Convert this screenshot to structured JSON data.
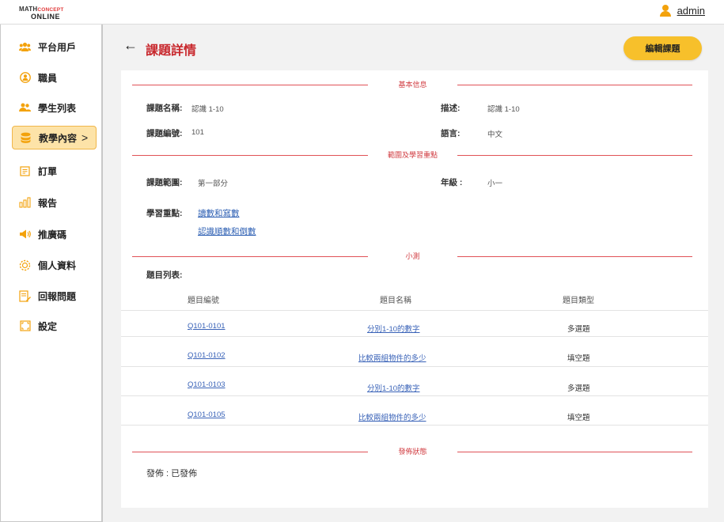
{
  "header": {
    "logo_line1_a": "Math",
    "logo_line1_b": "Concept",
    "logo_line2": "ONLINE",
    "user_name": "admin"
  },
  "sidebar": {
    "items": [
      {
        "label": "平台用戶",
        "icon": "users-icon"
      },
      {
        "label": "職員",
        "icon": "staff-icon"
      },
      {
        "label": "學生列表",
        "icon": "students-icon"
      },
      {
        "label": "教學內容",
        "icon": "teaching-icon",
        "active": true
      },
      {
        "label": "訂單",
        "icon": "order-icon"
      },
      {
        "label": "報告",
        "icon": "report-icon"
      },
      {
        "label": "推廣碼",
        "icon": "promo-icon"
      },
      {
        "label": "個人資料",
        "icon": "profile-icon"
      },
      {
        "label": "回報問題",
        "icon": "feedback-icon"
      },
      {
        "label": "設定",
        "icon": "settings-icon"
      }
    ],
    "active_chevron": ">"
  },
  "page": {
    "back_arrow": "←",
    "title": "課題詳情",
    "edit_button": "編輯課題"
  },
  "basic": {
    "section": "基本信息",
    "name_label": "課題名稱:",
    "name_value": "認識 1-10",
    "desc_label": "描述:",
    "desc_value": "認識 1-10",
    "code_label": "課題編號:",
    "code_value": "101",
    "lang_label": "語言:",
    "lang_value": "中文"
  },
  "scope": {
    "section": "範圍及學習重點",
    "range_label": "課題範圍:",
    "range_value": "第一部分",
    "grade_label": "年級 :",
    "grade_value": "小一",
    "focus_label": "學習重點:",
    "focus_items": [
      "讀數和寫數",
      "認識順數和倒數"
    ]
  },
  "quiz": {
    "section": "小測",
    "list_label": "題目列表:",
    "columns": [
      "題目編號",
      "題目名稱",
      "題目類型"
    ],
    "rows": [
      {
        "code": "Q101-0101",
        "name": "分別1-10的數字",
        "type": "多選題"
      },
      {
        "code": "Q101-0102",
        "name": "比較兩組物件的多少",
        "type": "填空題"
      },
      {
        "code": "Q101-0103",
        "name": "分別1-10的數字",
        "type": "多選題"
      },
      {
        "code": "Q101-0105",
        "name": "比較兩組物件的多少",
        "type": "填空題"
      }
    ]
  },
  "publish": {
    "section": "發佈狀態",
    "status": "發佈 : 已發佈"
  },
  "colors": {
    "accent_red": "#c8282d",
    "accent_yellow": "#f7c02b",
    "link_blue": "#2d5fb3"
  }
}
